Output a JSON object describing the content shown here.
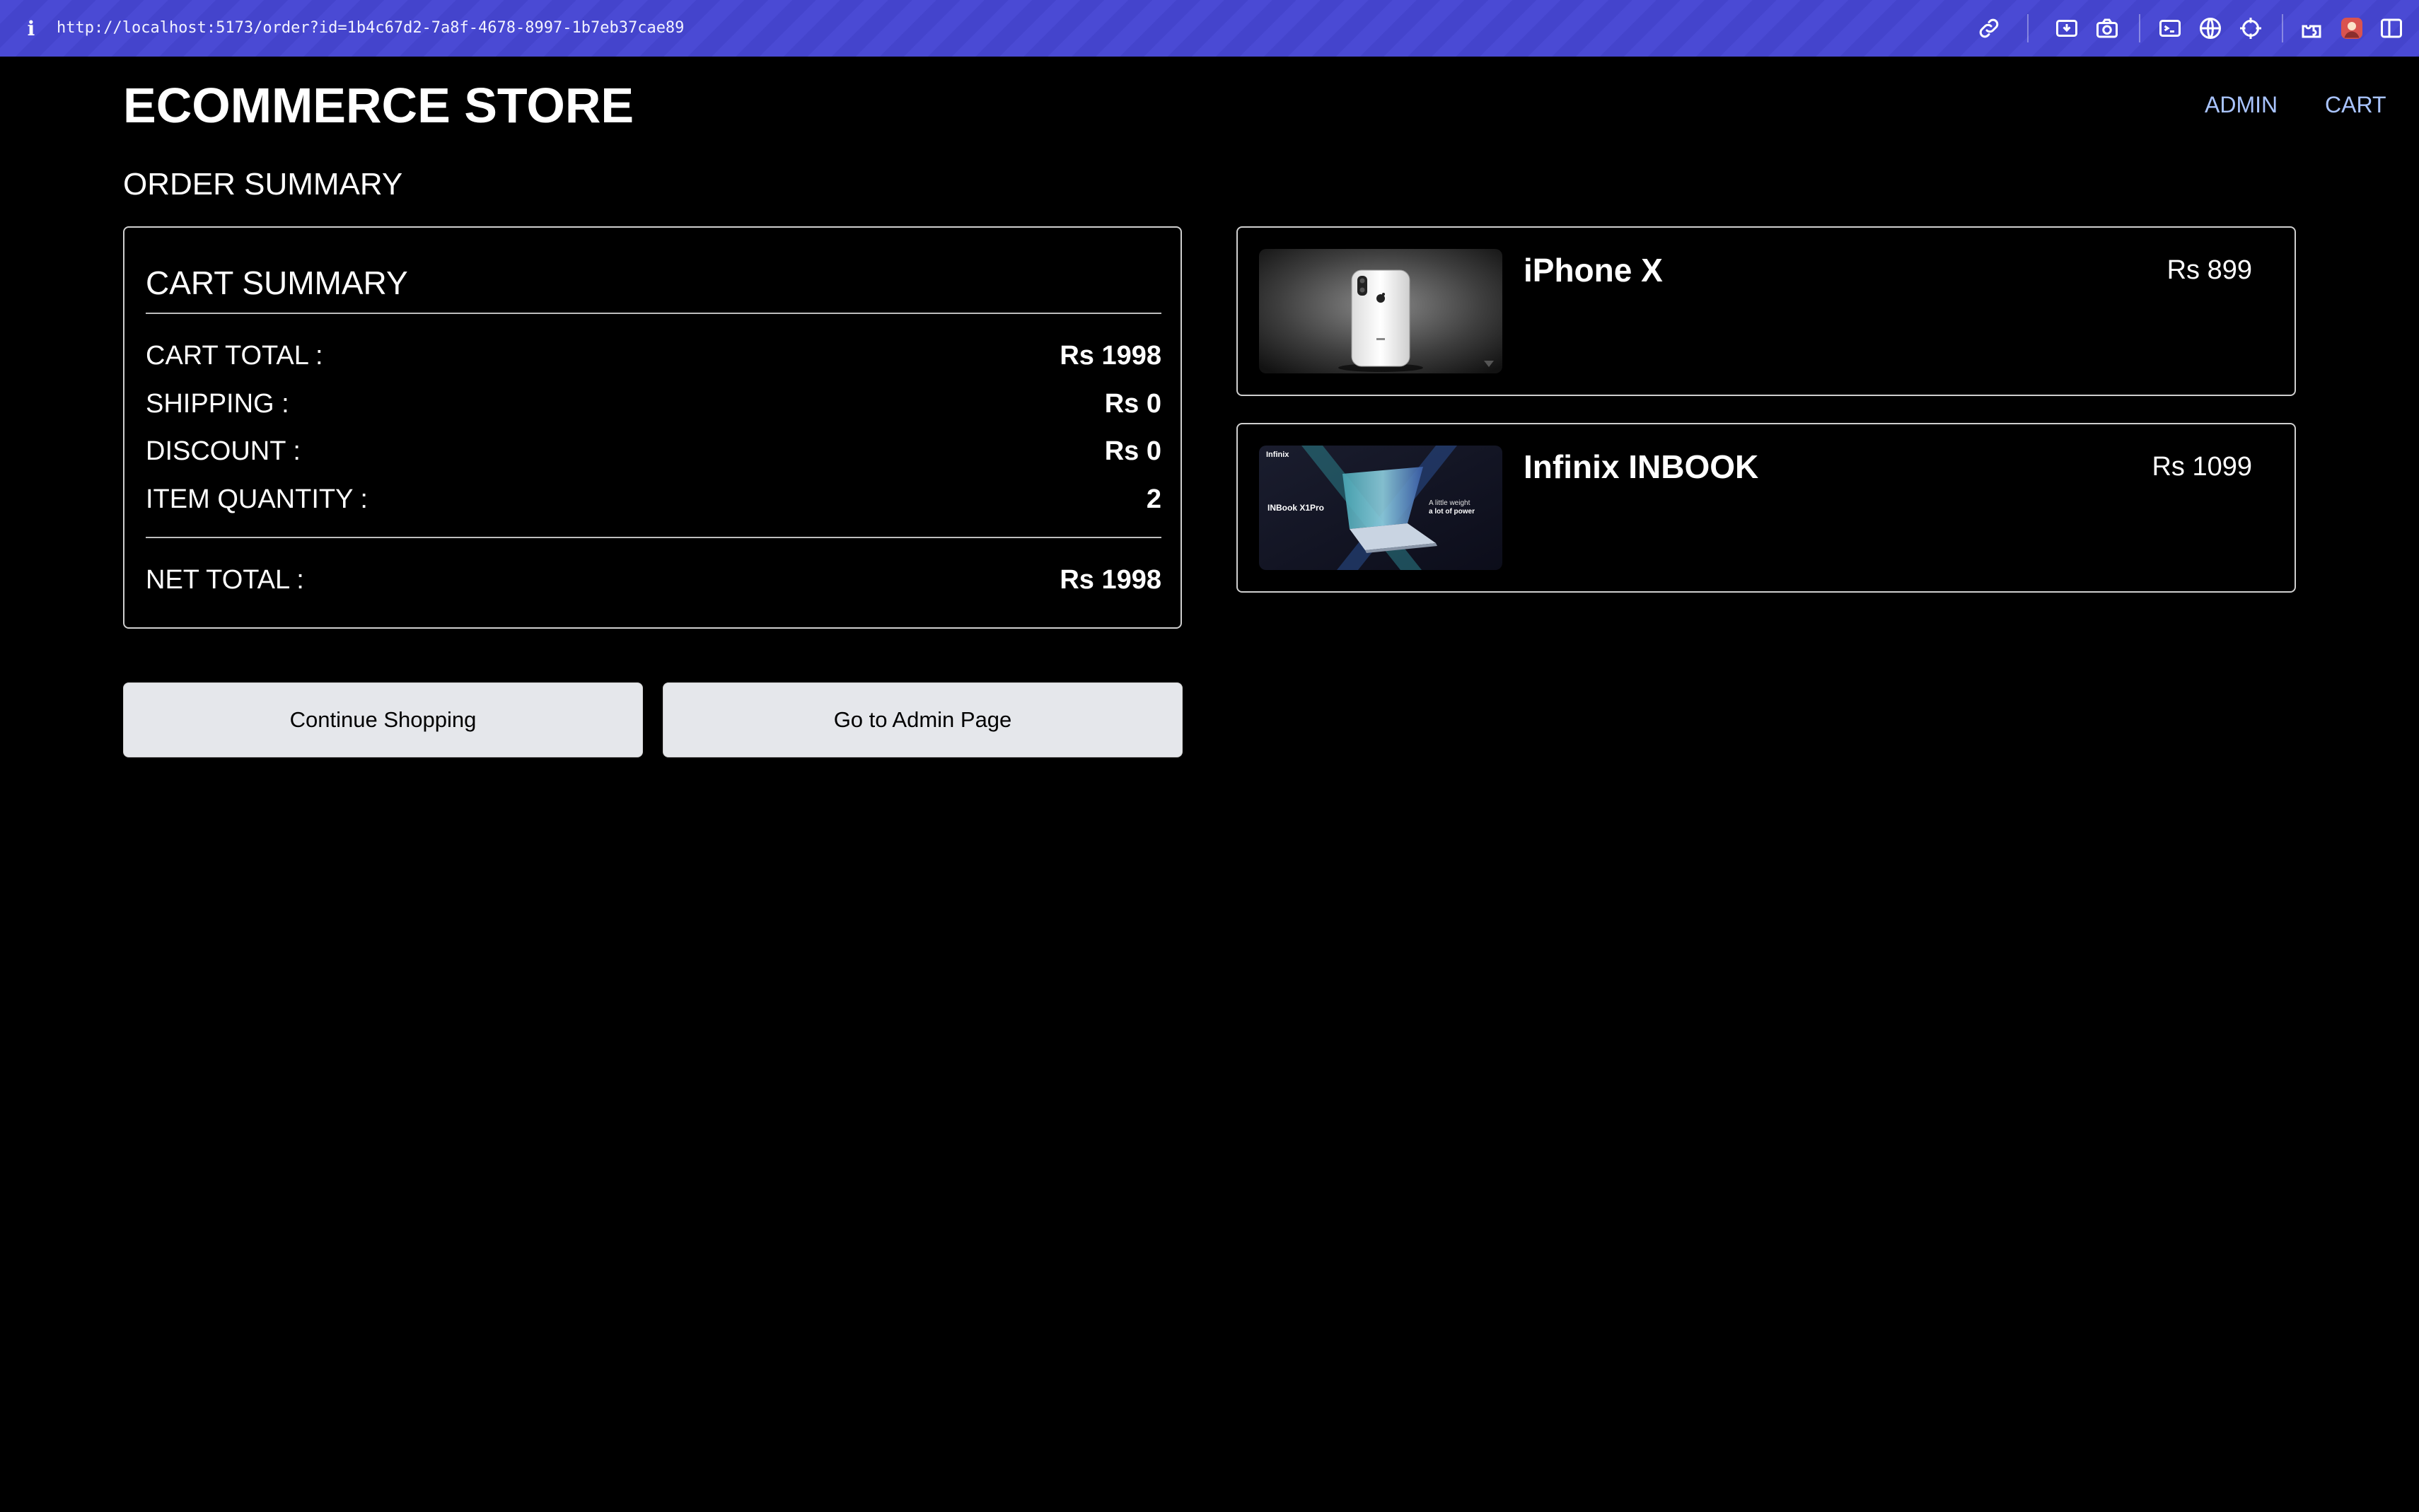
{
  "browser": {
    "url": "http://localhost:5173/order?id=1b4c67d2-7a8f-4678-8997-1b7eb37cae89",
    "info_icon": "i",
    "toolbar_icons": [
      "link-icon",
      "download-icon",
      "camera-icon",
      "terminal-icon",
      "globe-icon",
      "crosshair-icon",
      "extensions-icon",
      "profile-icon",
      "sidebar-icon"
    ]
  },
  "header": {
    "title": "ECOMMERCE STORE",
    "nav": {
      "admin": "ADMIN",
      "cart": "CART"
    },
    "link_color": "#a9c4ff"
  },
  "page": {
    "title": "ORDER SUMMARY"
  },
  "cart_summary": {
    "heading": "CART SUMMARY",
    "rows": [
      {
        "label": "CART TOTAL :",
        "value": "Rs 1998"
      },
      {
        "label": "SHIPPING :",
        "value": "Rs 0"
      },
      {
        "label": "DISCOUNT :",
        "value": "Rs 0"
      },
      {
        "label": "ITEM QUANTITY :",
        "value": "2"
      }
    ],
    "net_total": {
      "label": "NET TOTAL :",
      "value": "Rs 1998"
    }
  },
  "buttons": {
    "continue": "Continue Shopping",
    "admin": "Go to Admin Page"
  },
  "products": [
    {
      "name": "iPhone X",
      "price": "Rs 899"
    },
    {
      "name": "Infinix INBOOK",
      "price": "Rs 1099",
      "image_text": {
        "brand": "Infinix",
        "model": "INBook X1Pro",
        "tagline_1": "A little weight",
        "tagline_2": "a lot of power"
      }
    }
  ]
}
